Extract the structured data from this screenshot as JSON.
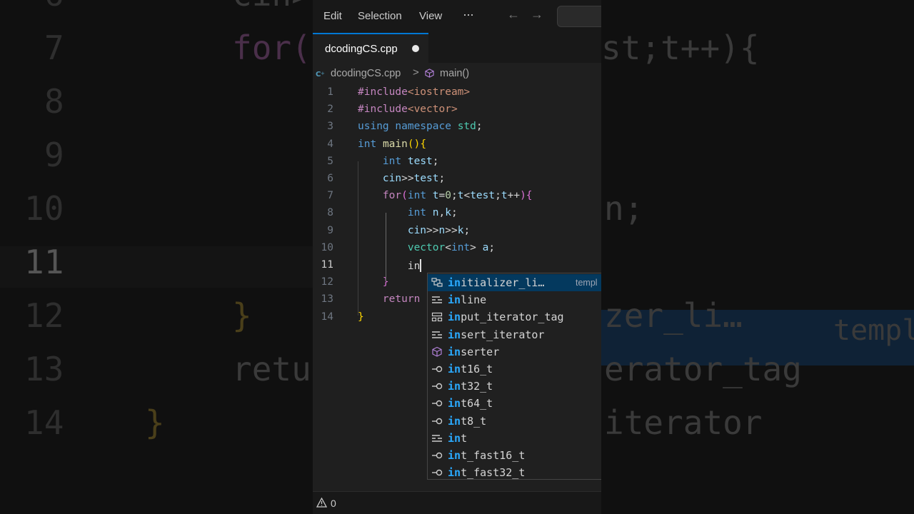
{
  "menubar": {
    "items": [
      "Edit",
      "Selection",
      "View",
      "···"
    ],
    "back_icon": "arrow-left-icon",
    "forward_icon": "arrow-right-icon"
  },
  "tab": {
    "filename": "dcodingCS.cpp",
    "modified": true
  },
  "breadcrumb": {
    "file": "dcodingCS.cpp",
    "separator": ">",
    "symbol": "main()"
  },
  "editor": {
    "active_line": 11,
    "lines": [
      {
        "n": "1",
        "tokens": [
          {
            "t": "#include",
            "c": "tk-pp"
          },
          {
            "t": "<iostream>",
            "c": "tk-str"
          }
        ]
      },
      {
        "n": "2",
        "tokens": [
          {
            "t": "#include",
            "c": "tk-pp"
          },
          {
            "t": "<vector>",
            "c": "tk-str"
          }
        ]
      },
      {
        "n": "3",
        "tokens": [
          {
            "t": "using",
            "c": "tk-kw"
          },
          {
            "t": " ",
            "c": "tk-p"
          },
          {
            "t": "namespace",
            "c": "tk-kw"
          },
          {
            "t": " ",
            "c": "tk-p"
          },
          {
            "t": "std",
            "c": "tk-ty"
          },
          {
            "t": ";",
            "c": "tk-p"
          }
        ]
      },
      {
        "n": "4",
        "tokens": [
          {
            "t": "int",
            "c": "tk-kw"
          },
          {
            "t": " ",
            "c": "tk-p"
          },
          {
            "t": "main",
            "c": "tk-fn"
          },
          {
            "t": "()",
            "c": "tk-b1"
          },
          {
            "t": "{",
            "c": "tk-b1"
          }
        ]
      },
      {
        "n": "5",
        "tokens": [
          {
            "t": "    ",
            "c": "tk-p"
          },
          {
            "t": "int",
            "c": "tk-kw"
          },
          {
            "t": " ",
            "c": "tk-p"
          },
          {
            "t": "test",
            "c": "tk-var"
          },
          {
            "t": ";",
            "c": "tk-p"
          }
        ]
      },
      {
        "n": "6",
        "tokens": [
          {
            "t": "    ",
            "c": "tk-p"
          },
          {
            "t": "cin",
            "c": "tk-var"
          },
          {
            "t": ">>",
            "c": "tk-p"
          },
          {
            "t": "test",
            "c": "tk-var"
          },
          {
            "t": ";",
            "c": "tk-p"
          }
        ]
      },
      {
        "n": "7",
        "tokens": [
          {
            "t": "    ",
            "c": "tk-p"
          },
          {
            "t": "for",
            "c": "tk-ctl"
          },
          {
            "t": "(",
            "c": "tk-b2"
          },
          {
            "t": "int",
            "c": "tk-kw"
          },
          {
            "t": " ",
            "c": "tk-p"
          },
          {
            "t": "t",
            "c": "tk-var"
          },
          {
            "t": "=",
            "c": "tk-p"
          },
          {
            "t": "0",
            "c": "tk-num"
          },
          {
            "t": ";",
            "c": "tk-p"
          },
          {
            "t": "t",
            "c": "tk-var"
          },
          {
            "t": "<",
            "c": "tk-p"
          },
          {
            "t": "test",
            "c": "tk-var"
          },
          {
            "t": ";",
            "c": "tk-p"
          },
          {
            "t": "t",
            "c": "tk-var"
          },
          {
            "t": "++",
            "c": "tk-p"
          },
          {
            "t": ")",
            "c": "tk-b2"
          },
          {
            "t": "{",
            "c": "tk-b2"
          }
        ]
      },
      {
        "n": "8",
        "tokens": [
          {
            "t": "        ",
            "c": "tk-p"
          },
          {
            "t": "int",
            "c": "tk-kw"
          },
          {
            "t": " ",
            "c": "tk-p"
          },
          {
            "t": "n",
            "c": "tk-var"
          },
          {
            "t": ",",
            "c": "tk-p"
          },
          {
            "t": "k",
            "c": "tk-var"
          },
          {
            "t": ";",
            "c": "tk-p"
          }
        ]
      },
      {
        "n": "9",
        "tokens": [
          {
            "t": "        ",
            "c": "tk-p"
          },
          {
            "t": "cin",
            "c": "tk-var"
          },
          {
            "t": ">>",
            "c": "tk-p"
          },
          {
            "t": "n",
            "c": "tk-var"
          },
          {
            "t": ">>",
            "c": "tk-p"
          },
          {
            "t": "k",
            "c": "tk-var"
          },
          {
            "t": ";",
            "c": "tk-p"
          }
        ]
      },
      {
        "n": "10",
        "tokens": [
          {
            "t": "        ",
            "c": "tk-p"
          },
          {
            "t": "vector",
            "c": "tk-ty"
          },
          {
            "t": "<",
            "c": "tk-p"
          },
          {
            "t": "int",
            "c": "tk-kw"
          },
          {
            "t": ">",
            "c": "tk-p"
          },
          {
            "t": " ",
            "c": "tk-p"
          },
          {
            "t": "a",
            "c": "tk-var"
          },
          {
            "t": ";",
            "c": "tk-p"
          }
        ]
      },
      {
        "n": "11",
        "tokens": [
          {
            "t": "        ",
            "c": "tk-p"
          },
          {
            "t": "in",
            "c": "tk-p"
          }
        ],
        "cursor": true
      },
      {
        "n": "12",
        "tokens": [
          {
            "t": "    ",
            "c": "tk-p"
          },
          {
            "t": "}",
            "c": "tk-b2"
          }
        ]
      },
      {
        "n": "13",
        "tokens": [
          {
            "t": "    ",
            "c": "tk-p"
          },
          {
            "t": "return",
            "c": "tk-ctl"
          }
        ]
      },
      {
        "n": "14",
        "tokens": [
          {
            "t": "}",
            "c": "tk-b1"
          }
        ]
      }
    ]
  },
  "suggestions": [
    {
      "match": "in",
      "rest": "itializer_li…",
      "icon": "template-icon",
      "detail": "templ",
      "selected": true
    },
    {
      "match": "in",
      "rest": "line",
      "icon": "keyword-icon"
    },
    {
      "match": "in",
      "rest": "put_iterator_tag",
      "icon": "struct-icon"
    },
    {
      "match": "in",
      "rest": "sert_iterator",
      "icon": "keyword-icon"
    },
    {
      "match": "in",
      "rest": "serter",
      "icon": "method-icon"
    },
    {
      "match": "in",
      "rest": "t16_t",
      "icon": "typedef-icon"
    },
    {
      "match": "in",
      "rest": "t32_t",
      "icon": "typedef-icon"
    },
    {
      "match": "in",
      "rest": "t64_t",
      "icon": "typedef-icon"
    },
    {
      "match": "in",
      "rest": "t8_t",
      "icon": "typedef-icon"
    },
    {
      "match": "in",
      "rest": "t",
      "icon": "keyword-icon"
    },
    {
      "match": "in",
      "rest": "t_fast16_t",
      "icon": "typedef-icon"
    },
    {
      "match": "in",
      "rest": "t_fast32_t",
      "icon": "typedef-icon"
    }
  ],
  "statusbar": {
    "icon": "warning-icon",
    "warnings": "0"
  },
  "background_zoom": {
    "left_line_numbers": [
      "6",
      "7",
      "8",
      "9",
      "10",
      "11",
      "12",
      "13",
      "14"
    ],
    "left_code": [
      "cin>",
      "for(",
      "",
      "",
      "",
      "",
      "}",
      "retu",
      "}"
    ],
    "right_code": [
      "",
      "st;t++){",
      "",
      "",
      "n;",
      "",
      "zer_li…",
      "erator_tag",
      "iterator"
    ],
    "right_detail": "templ"
  },
  "colors": {
    "accent": "#0078d4",
    "match": "#2aaaff",
    "selection": "#04395e",
    "editor_bg": "#1f1f1f"
  }
}
